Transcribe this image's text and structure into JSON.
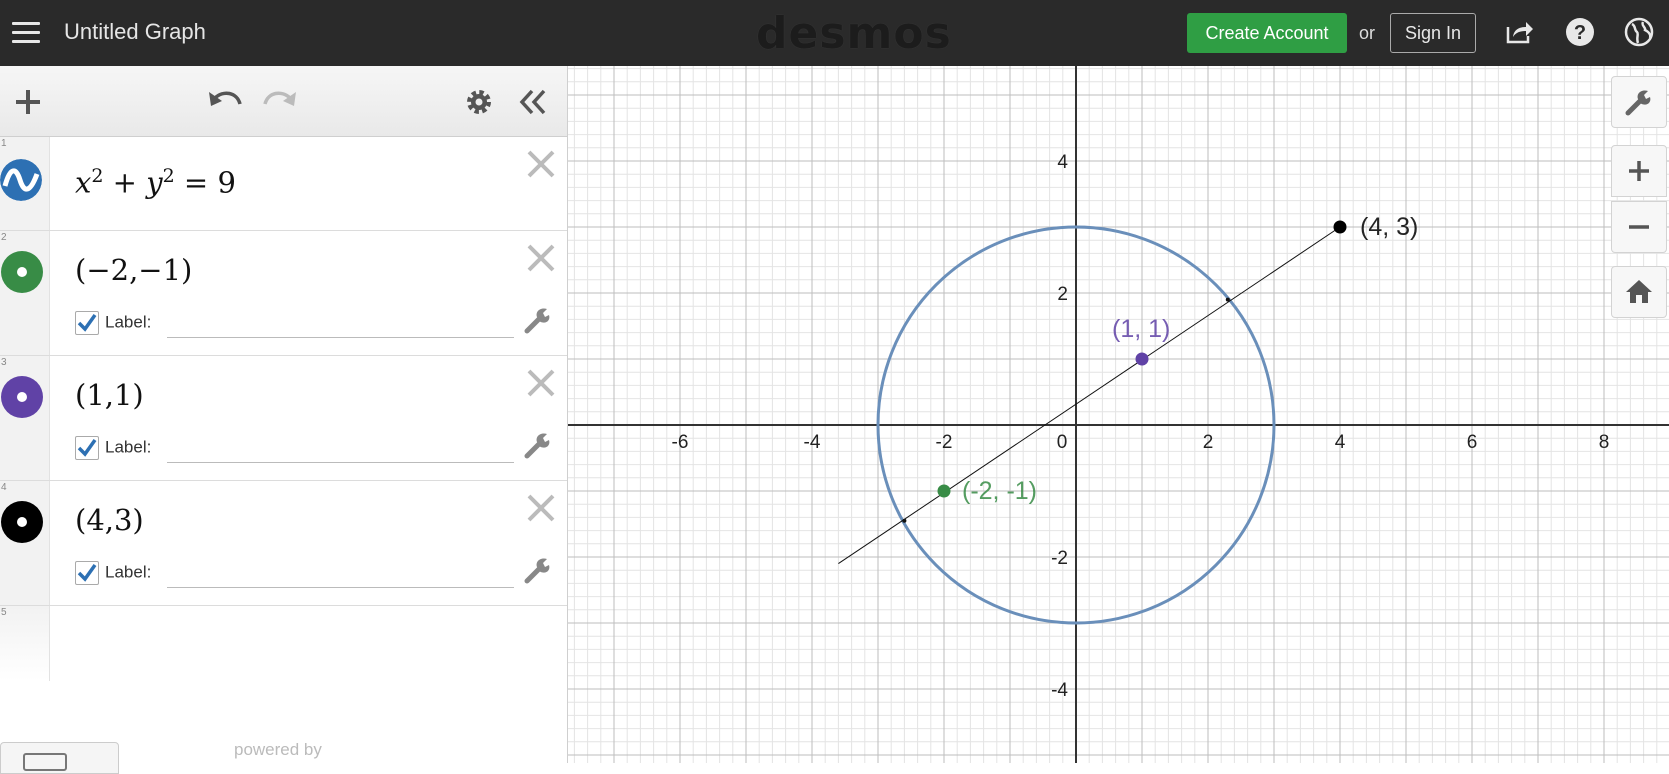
{
  "header": {
    "menu_icon": "hamburger-menu-icon",
    "title": "Untitled Graph",
    "logo": "desmos",
    "create_account": "Create Account",
    "or": "or",
    "sign_in": "Sign In",
    "icons": [
      "share-icon",
      "help-icon",
      "globe-icon"
    ]
  },
  "toolbar": {
    "icons": [
      "add-icon",
      "undo-icon",
      "redo-icon",
      "settings-gear-icon",
      "collapse-panel-icon"
    ]
  },
  "expressions": [
    {
      "index": "1",
      "kind": "equation",
      "color": "#2d70b3"
    },
    {
      "index": "2",
      "kind": "point",
      "text": "(−2,−1)",
      "color": "#388c46",
      "label_text": "Label:",
      "label_checked": true
    },
    {
      "index": "3",
      "kind": "point",
      "text": "(1,1)",
      "color": "#6042a6",
      "label_text": "Label:",
      "label_checked": true
    },
    {
      "index": "4",
      "kind": "point",
      "text": "(4,3)",
      "color": "#000000",
      "label_text": "Label:",
      "label_checked": true
    },
    {
      "index": "5",
      "kind": "empty"
    }
  ],
  "equation_parts": {
    "x": "x",
    "y": "y",
    "exp": "2",
    "plus": "+",
    "eq": "=",
    "rhs": "9"
  },
  "footer": {
    "powered_by": "powered by"
  },
  "graph": {
    "x_range": [
      -8.2,
      9.0
    ],
    "y_range": [
      -5.1,
      5.5
    ],
    "x_tick_labels": [
      "-6",
      "-4",
      "-2",
      "0",
      "2",
      "4",
      "6",
      "8"
    ],
    "y_tick_labels": [
      "4",
      "2",
      "-2",
      "-4"
    ],
    "circle": {
      "center": [
        0,
        0
      ],
      "radius": 3,
      "color": "#6a8fba"
    },
    "points": [
      {
        "x": -2,
        "y": -1,
        "label": "(-2, -1)",
        "color": "#388c46"
      },
      {
        "x": 1,
        "y": 1,
        "label": "(1, 1)",
        "color": "#6042a6"
      },
      {
        "x": 4,
        "y": 3,
        "label": "(4, 3)",
        "color": "#000000"
      }
    ],
    "line_through": [
      [
        -3.6,
        -2.1
      ],
      [
        4.0,
        3.0
      ]
    ],
    "intersections": [
      [
        -2.6,
        -1.45
      ],
      [
        2.3,
        1.9
      ]
    ],
    "right_controls": [
      "wrench-settings-icon",
      "zoom-in-icon",
      "zoom-out-icon",
      "home-icon"
    ]
  }
}
